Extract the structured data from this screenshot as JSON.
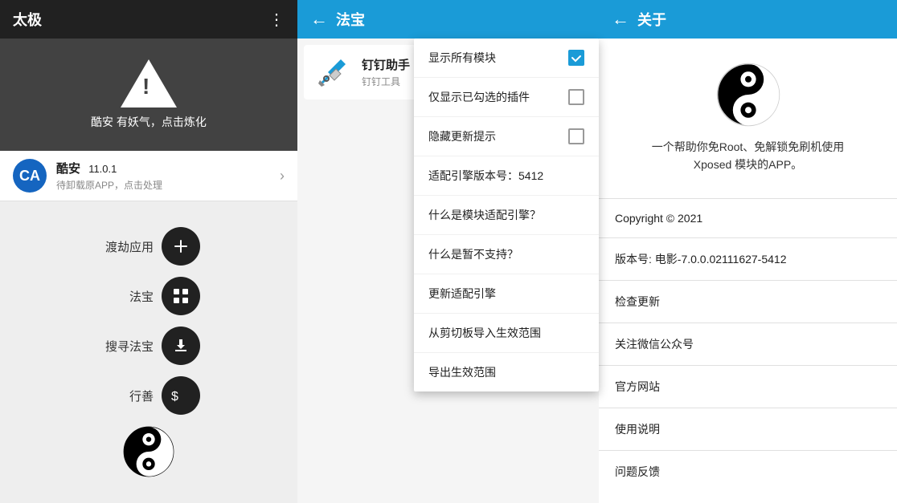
{
  "left": {
    "header_title": "太极",
    "dots_icon": "⋮",
    "banner_text": "酷安 有妖气，点击炼化",
    "app_item": {
      "name": "酷安",
      "version": "11.0.1",
      "sub": "待卸载原APP，点击处理"
    },
    "buttons": [
      {
        "label": "渡劫应用",
        "icon": "plus"
      },
      {
        "label": "法宝",
        "icon": "grid"
      },
      {
        "label": "搜寻法宝",
        "icon": "download"
      },
      {
        "label": "行善",
        "icon": "dollar"
      }
    ]
  },
  "middle": {
    "header_back": "←",
    "header_title": "法宝",
    "plugin_name": "钉钉助手",
    "plugin_sub": "钉钉工具",
    "dropdown": {
      "items": [
        {
          "type": "checkbox-checked",
          "label": "显示所有模块"
        },
        {
          "type": "checkbox-unchecked",
          "label": "仅显示已勾选的插件"
        },
        {
          "type": "checkbox-unchecked",
          "label": "隐藏更新提示"
        },
        {
          "type": "version",
          "label": "适配引擎版本号：5412"
        },
        {
          "type": "link",
          "label": "什么是模块适配引擎？"
        },
        {
          "type": "link",
          "label": "什么是暂不支持？"
        },
        {
          "type": "link",
          "label": "更新适配引擎"
        },
        {
          "type": "link",
          "label": "从剪切板导入生效范围"
        },
        {
          "type": "link",
          "label": "导出生效范围"
        }
      ]
    }
  },
  "right": {
    "header_back": "←",
    "header_title": "关于",
    "about_desc": "一个帮助你免Root、免解锁免刷机使用\nXposed 模块的APP。",
    "menu_items": [
      {
        "label": "Copyright © 2021"
      },
      {
        "label": "版本号: 电影-7.0.0.02111627-5412"
      },
      {
        "label": "检查更新"
      },
      {
        "label": "关注微信公众号"
      },
      {
        "label": "官方网站"
      },
      {
        "label": "使用说明"
      },
      {
        "label": "问题反馈"
      }
    ]
  }
}
